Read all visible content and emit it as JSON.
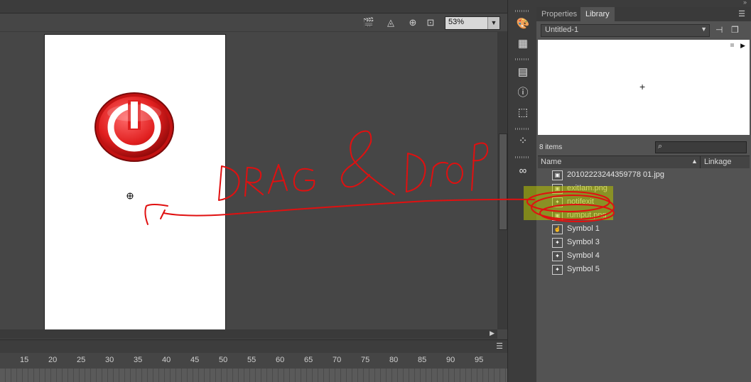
{
  "stage": {
    "zoom": "53%",
    "toolbar_icons": [
      "edit-scene-icon",
      "edit-symbols-icon",
      "snap-icon",
      "clip-icon"
    ]
  },
  "timeline": {
    "ruler": [
      "15",
      "20",
      "25",
      "30",
      "35",
      "40",
      "45",
      "50",
      "55",
      "60",
      "65",
      "70",
      "75",
      "80",
      "85",
      "90",
      "95"
    ]
  },
  "tools": [
    "color-palette-icon",
    "swatches-icon",
    "align-icon",
    "info-icon",
    "transform-icon",
    "components-icon",
    "creative-cloud-icon"
  ],
  "library": {
    "tabs": {
      "properties": "Properties",
      "library": "Library"
    },
    "document": "Untitled-1",
    "items_count": "8 items",
    "search_placeholder": "",
    "columns": {
      "name": "Name",
      "linkage": "Linkage"
    },
    "items": [
      {
        "label": "20102223244359778 01.jpg",
        "icon": "bitmap-icon"
      },
      {
        "label": "exitIam.png",
        "icon": "bitmap-icon"
      },
      {
        "label": "notifexit",
        "icon": "movieclip-icon"
      },
      {
        "label": "rumput.png",
        "icon": "bitmap-icon"
      },
      {
        "label": "Symbol 1",
        "icon": "button-icon"
      },
      {
        "label": "Symbol 3",
        "icon": "movieclip-icon"
      },
      {
        "label": "Symbol 4",
        "icon": "movieclip-icon"
      },
      {
        "label": "Symbol 5",
        "icon": "movieclip-icon"
      }
    ]
  },
  "annotation": {
    "text": "DRAG & DROP",
    "color": "#e01010"
  },
  "colors": {
    "highlight": "#b8c400",
    "annotation": "#e01010",
    "power_button": "#e01f1f"
  }
}
